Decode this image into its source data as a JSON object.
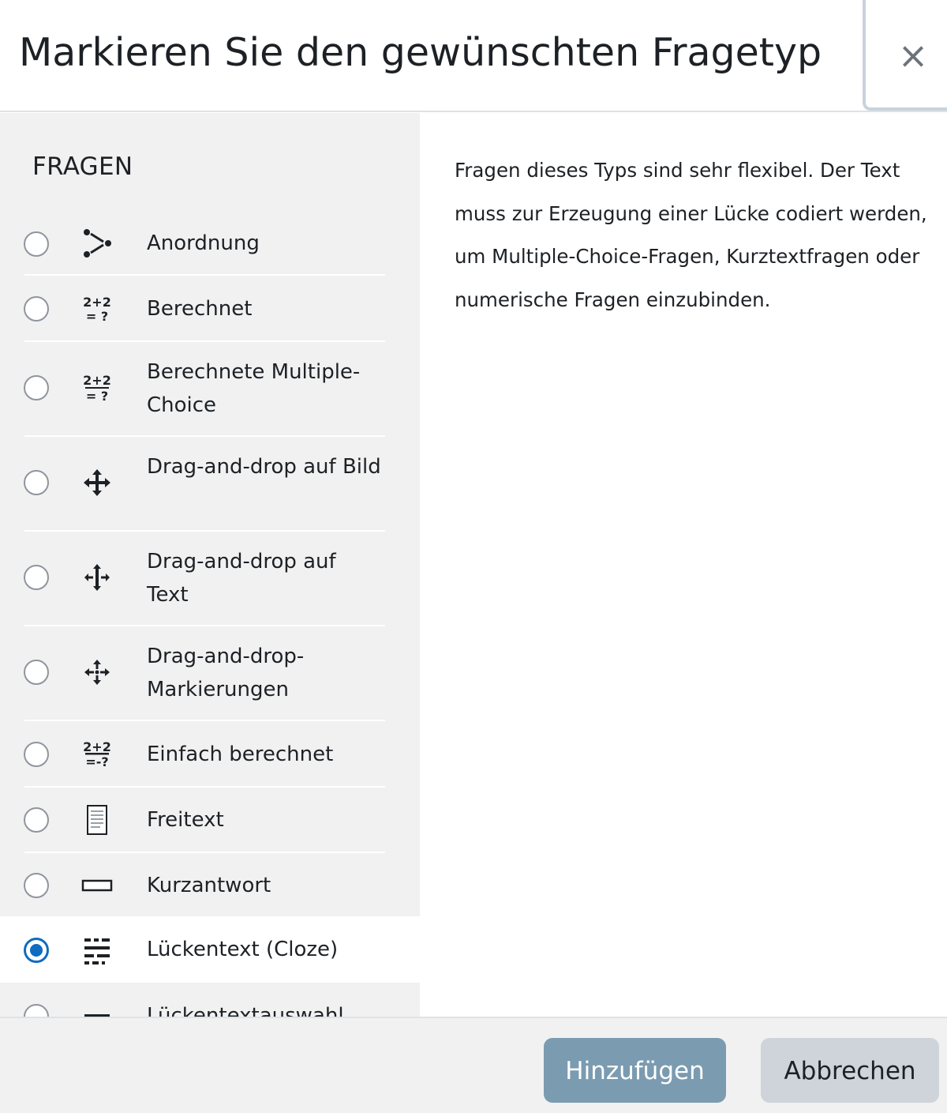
{
  "dialog": {
    "title": "Markieren Sie den gewünschten Fragetyp",
    "close_symbol": "×"
  },
  "sidebar": {
    "section_title": "FRAGEN",
    "options": [
      {
        "label": "Anordnung",
        "icon": "ordering-icon",
        "selected": false
      },
      {
        "label": "Berechnet",
        "icon": "calculated-icon",
        "selected": false
      },
      {
        "label": "Berechnete Multiple-Choice",
        "icon": "calculated-multichoice-icon",
        "selected": false
      },
      {
        "label": "Drag-and-drop auf Bild",
        "icon": "drag-drop-image-icon",
        "selected": false
      },
      {
        "label": "Drag-and-drop auf Text",
        "icon": "drag-drop-text-icon",
        "selected": false
      },
      {
        "label": "Drag-and-drop-Markierungen",
        "icon": "drag-drop-markers-icon",
        "selected": false
      },
      {
        "label": "Einfach berechnet",
        "icon": "simple-calculated-icon",
        "selected": false
      },
      {
        "label": "Freitext",
        "icon": "essay-icon",
        "selected": false
      },
      {
        "label": "Kurzantwort",
        "icon": "short-answer-icon",
        "selected": false
      },
      {
        "label": "Lückentext (Cloze)",
        "icon": "cloze-icon",
        "selected": true
      },
      {
        "label": "Lückentextauswahl",
        "icon": "gapselect-icon",
        "selected": false
      }
    ]
  },
  "description": "Fragen dieses Typs sind sehr flexibel. Der Text muss zur Erzeugung einer Lücke codiert werden, um Multiple-Choice-Fragen, Kurztextfragen oder numerische Fragen einzubinden.",
  "footer": {
    "add_label": "Hinzufügen",
    "cancel_label": "Abbrechen"
  },
  "colors": {
    "accent": "#0f6cbf",
    "sidebar_bg": "#f1f1f1",
    "add_button": "#7b9bb0",
    "cancel_button": "#ced4da"
  }
}
